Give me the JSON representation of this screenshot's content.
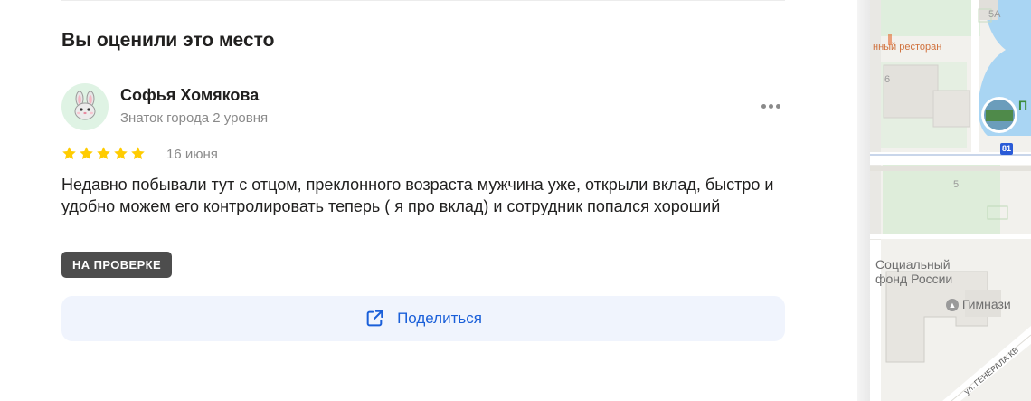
{
  "section": {
    "title": "Вы оценили это место"
  },
  "review": {
    "author_name": "Софья Хомякова",
    "author_level": "Знаток города 2 уровня",
    "rating": 5,
    "date": "16 июня",
    "text": "Недавно побывали тут с отцом, преклонного возраста мужчина уже, открыли вклад, быстро и удобно можем его контролировать теперь ( я про вклад) и сотрудник попался хороший",
    "status_badge": "НА ПРОВЕРКЕ",
    "share_label": "Поделиться"
  },
  "map": {
    "label_restaurant": "нный ресторан",
    "label_social_line1": "Социальный",
    "label_social_line2": "фонд России",
    "label_gymnasium": "Гимнази",
    "label_street": "ул. ГЕНЕРАЛА КВ",
    "label_park_letter": "П",
    "house_5a": "5А",
    "house_6": "6",
    "house_5": "5",
    "route_badge": "81"
  },
  "colors": {
    "accent_blue": "#1a5fd9",
    "star_yellow": "#fc0",
    "badge_dark": "#4d4d4d",
    "share_bg": "#f0f4fd",
    "avatar_bg": "#dff3e4"
  },
  "icons": {
    "avatar": "bunny-icon",
    "more": "more-dots-icon",
    "star": "star-icon",
    "share": "share-external-icon",
    "gymnasium": "graduation-cap-icon"
  }
}
